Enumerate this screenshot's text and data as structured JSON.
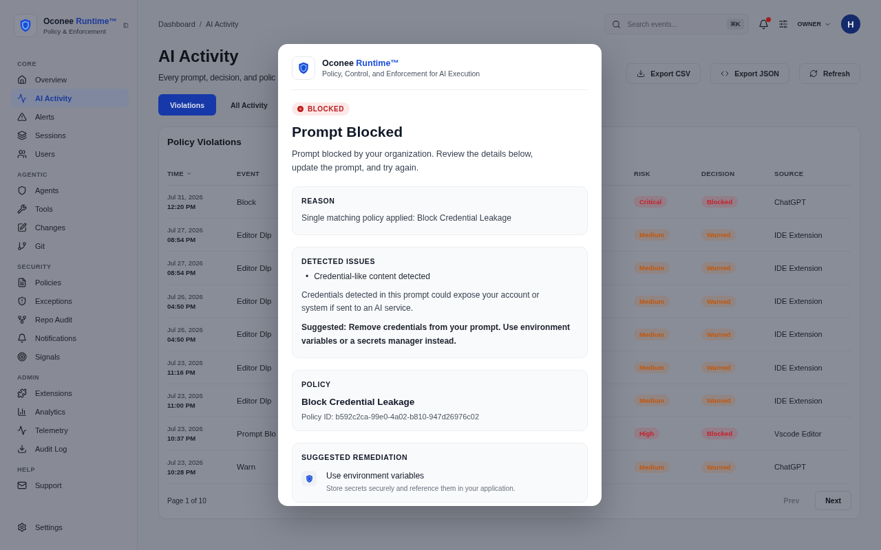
{
  "brand": {
    "name": "Oconee",
    "name_accent": "Runtime™",
    "tagline": "Policy & Enforcement"
  },
  "sidebar": {
    "sections": [
      {
        "title": "CORE",
        "items": [
          {
            "label": "Overview",
            "selected": false
          },
          {
            "label": "AI Activity",
            "selected": true
          },
          {
            "label": "Alerts",
            "selected": false
          },
          {
            "label": "Sessions",
            "selected": false
          },
          {
            "label": "Users",
            "selected": false
          }
        ]
      },
      {
        "title": "AGENTIC",
        "items": [
          {
            "label": "Agents",
            "selected": false
          },
          {
            "label": "Tools",
            "selected": false
          },
          {
            "label": "Changes",
            "selected": false
          },
          {
            "label": "Git",
            "selected": false
          }
        ]
      },
      {
        "title": "SECURITY",
        "items": [
          {
            "label": "Policies",
            "selected": false
          },
          {
            "label": "Exceptions",
            "selected": false
          },
          {
            "label": "Repo Audit",
            "selected": false
          },
          {
            "label": "Notifications",
            "selected": false
          },
          {
            "label": "Signals",
            "selected": false
          }
        ]
      },
      {
        "title": "ADMIN",
        "items": [
          {
            "label": "Extensions",
            "selected": false
          },
          {
            "label": "Analytics",
            "selected": false
          },
          {
            "label": "Telemetry",
            "selected": false
          },
          {
            "label": "Audit Log",
            "selected": false
          }
        ]
      },
      {
        "title": "HELP",
        "items": [
          {
            "label": "Support",
            "selected": false
          }
        ]
      }
    ],
    "footer_item": {
      "label": "Settings",
      "selected": false
    }
  },
  "breadcrumbs": [
    "Dashboard",
    "AI Activity"
  ],
  "breadcrumb_separator": "/",
  "topbar": {
    "search": {
      "placeholder": "Search events...",
      "shortcut": "⌘K"
    },
    "role": "OWNER",
    "avatar": "H"
  },
  "page": {
    "title": "AI Activity",
    "subtitle": "Every prompt, decision, and polic",
    "actions": [
      "Export CSV",
      "Export JSON",
      "Refresh"
    ]
  },
  "tabs": [
    {
      "label": "Violations",
      "selected": true
    },
    {
      "label": "All Activity",
      "selected": false
    }
  ],
  "table": {
    "title": "Policy Violations",
    "columns": [
      "TIME",
      "EVENT",
      "RISK",
      "DECISION",
      "SOURCE"
    ],
    "rows": [
      {
        "date": "Jul 31, 2026",
        "time": "12:20 PM",
        "event": "Block",
        "risk": {
          "text": "Critical",
          "color": "#c8202c"
        },
        "decision": {
          "text": "Blocked",
          "color": "#c8202c"
        },
        "source": "ChatGPT"
      },
      {
        "date": "Jul 27, 2026",
        "time": "08:54 PM",
        "event": "Editor Dlp",
        "risk": {
          "text": "Medium",
          "color": "#c2570c"
        },
        "decision": {
          "text": "Warned",
          "color": "#c2570c"
        },
        "source": "IDE Extension"
      },
      {
        "date": "Jul 27, 2026",
        "time": "08:54 PM",
        "event": "Editor Dlp",
        "risk": {
          "text": "Medium",
          "color": "#c2570c"
        },
        "decision": {
          "text": "Warned",
          "color": "#c2570c"
        },
        "source": "IDE Extension"
      },
      {
        "date": "Jul 26, 2026",
        "time": "04:50 PM",
        "event": "Editor Dlp",
        "risk": {
          "text": "Medium",
          "color": "#c2570c"
        },
        "decision": {
          "text": "Warned",
          "color": "#c2570c"
        },
        "source": "IDE Extension"
      },
      {
        "date": "Jul 26, 2026",
        "time": "04:50 PM",
        "event": "Editor Dlp",
        "risk": {
          "text": "Medium",
          "color": "#c2570c"
        },
        "decision": {
          "text": "Warned",
          "color": "#c2570c"
        },
        "source": "IDE Extension"
      },
      {
        "date": "Jul 23, 2026",
        "time": "11:16 PM",
        "event": "Editor Dlp",
        "risk": {
          "text": "Medium",
          "color": "#c2570c"
        },
        "decision": {
          "text": "Warned",
          "color": "#c2570c"
        },
        "source": "IDE Extension"
      },
      {
        "date": "Jul 23, 2026",
        "time": "11:00 PM",
        "event": "Editor Dlp",
        "risk": {
          "text": "Medium",
          "color": "#c2570c"
        },
        "decision": {
          "text": "Warned",
          "color": "#c2570c"
        },
        "source": "IDE Extension"
      },
      {
        "date": "Jul 23, 2026",
        "time": "10:37 PM",
        "event": "Prompt Blo",
        "risk": {
          "text": "High",
          "color": "#c8202c"
        },
        "decision": {
          "text": "Blocked",
          "color": "#c8202c"
        },
        "source": "Vscode Editor"
      },
      {
        "date": "Jul 23, 2026",
        "time": "10:28 PM",
        "event": "Warn",
        "risk": {
          "text": "Medium",
          "color": "#c2570c"
        },
        "decision": {
          "text": "Warned",
          "color": "#c2570c"
        },
        "source": "ChatGPT"
      }
    ],
    "pagination": {
      "label": "Page 1 of 10",
      "prev": {
        "label": "Prev",
        "disabled": true
      },
      "next": {
        "label": "Next",
        "disabled": false
      }
    }
  },
  "modal": {
    "brand": {
      "name": "Oconee",
      "name_accent": "Runtime™",
      "tagline": "Policy, Control, and Enforcement for AI Execution"
    },
    "status": "BLOCKED",
    "title": "Prompt Blocked",
    "description": "Prompt blocked by your organization. Review the details below, update the prompt, and try again.",
    "reason": {
      "label": "REASON",
      "text": "Single matching policy applied: Block Credential Leakage"
    },
    "issues": {
      "label": "DETECTED ISSUES",
      "items": [
        {
          "marker": "•",
          "text": "Credential-like content detected"
        }
      ],
      "explanation": "Credentials detected in this prompt could expose your account or system if sent to an AI service.",
      "suggestion": "Suggested: Remove credentials from your prompt. Use environment variables or a secrets manager instead."
    },
    "policy": {
      "label": "POLICY",
      "name": "Block Credential Leakage",
      "id": "Policy ID: b592c2ca-99e0-4a02-b810-947d26976c02"
    },
    "remediation": {
      "label": "SUGGESTED REMEDIATION",
      "items": [
        {
          "title": "Use environment variables",
          "text": "Store secrets securely and reference them in your application."
        }
      ]
    }
  }
}
